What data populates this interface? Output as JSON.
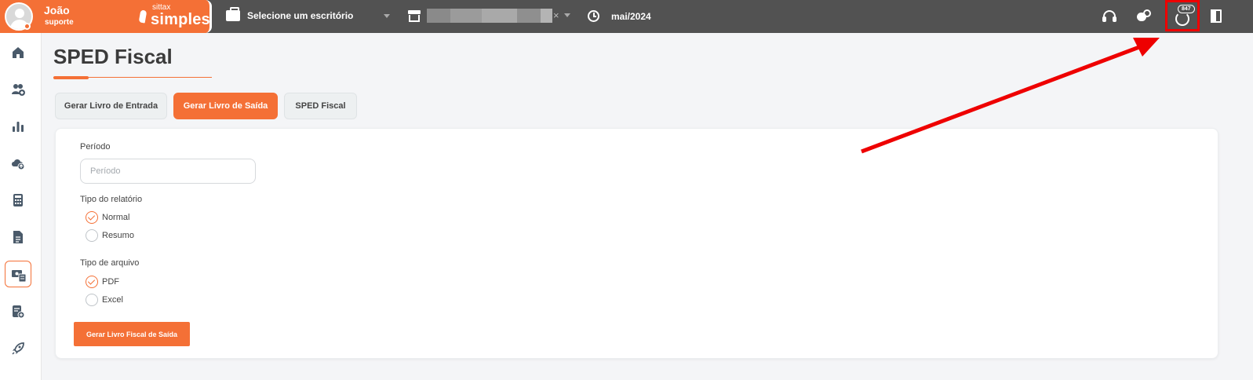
{
  "topbar": {
    "user": {
      "name": "João",
      "role": "suporte"
    },
    "logo": {
      "top": "sittax",
      "main": "simples"
    },
    "office_selector": {
      "label": "Selecione um escritório"
    },
    "store_selector": {
      "clear": "×"
    },
    "period": {
      "value": "mai/2024"
    },
    "notifications": {
      "count": "847"
    }
  },
  "sidebar": {
    "items": [
      {
        "name": "home-icon"
      },
      {
        "name": "users-icon"
      },
      {
        "name": "chart-icon"
      },
      {
        "name": "cloud-upload-icon"
      },
      {
        "name": "calculator-icon"
      },
      {
        "name": "document-icon"
      },
      {
        "name": "money-report-icon",
        "active": true
      },
      {
        "name": "invoice-add-icon"
      },
      {
        "name": "rocket-icon"
      }
    ]
  },
  "page": {
    "title": "SPED Fiscal"
  },
  "tabs": [
    {
      "label": "Gerar Livro de Entrada"
    },
    {
      "label": "Gerar Livro de Saída",
      "active": true
    },
    {
      "label": "SPED Fiscal"
    }
  ],
  "form": {
    "period": {
      "label": "Período",
      "placeholder": "Período"
    },
    "report_type": {
      "label": "Tipo do relatório",
      "options": [
        {
          "label": "Normal",
          "checked": true
        },
        {
          "label": "Resumo",
          "checked": false
        }
      ]
    },
    "file_type": {
      "label": "Tipo de arquivo",
      "options": [
        {
          "label": "PDF",
          "checked": true
        },
        {
          "label": "Excel",
          "checked": false
        }
      ]
    },
    "submit": "Gerar Livro Fiscal de Saída"
  },
  "colors": {
    "accent": "#f47036",
    "topbar": "#525252",
    "annotation": "#ee0000"
  }
}
